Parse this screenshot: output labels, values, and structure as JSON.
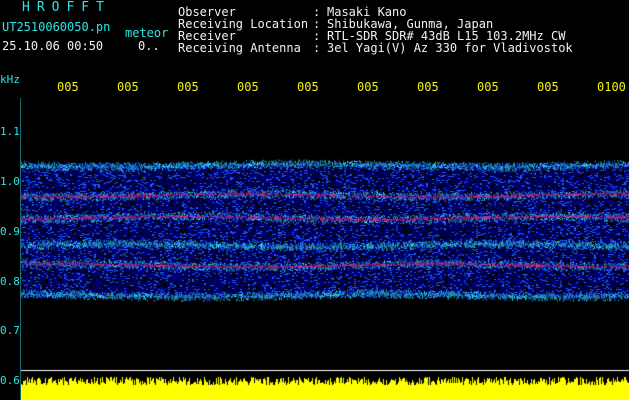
{
  "header": {
    "logo": "HROFFT",
    "file_name": "UT2510060050.pn",
    "tag": "meteor",
    "datetime": "25.10.06 00:50",
    "count": "0.."
  },
  "info": {
    "rows": [
      {
        "label": "Observer",
        "value": "Masaki Kano"
      },
      {
        "label": "Receiving Location",
        "value": "Shibukawa, Gunma, Japan"
      },
      {
        "label": "Receiver",
        "value": "RTL-SDR SDR# 43dB L15 103.2MHz CW"
      },
      {
        "label": "Receiving Antenna",
        "value": "3el Yagi(V) Az 330 for Vladivostok"
      }
    ]
  },
  "chart_data": {
    "type": "heatmap",
    "y_unit": "kHz",
    "x_tick_labels": [
      "005",
      "005",
      "005",
      "005",
      "005",
      "005",
      "005",
      "005",
      "005",
      "0100"
    ],
    "y_tick_labels": [
      "1.1",
      "1.0",
      "0.9",
      "0.8",
      "0.7",
      "0.6"
    ],
    "ylim": [
      0.6,
      1.14
    ],
    "signal_bands_khz": [
      1.03,
      0.97,
      0.925,
      0.87,
      0.83,
      0.77
    ],
    "colors": {
      "background": "#000000",
      "noise_floor": "#00007a",
      "weak": "#1e5aff",
      "medium": "#2ee0d0",
      "strong": "#f03070",
      "trace": "#ffff00",
      "labels": "#29e7e7"
    }
  }
}
